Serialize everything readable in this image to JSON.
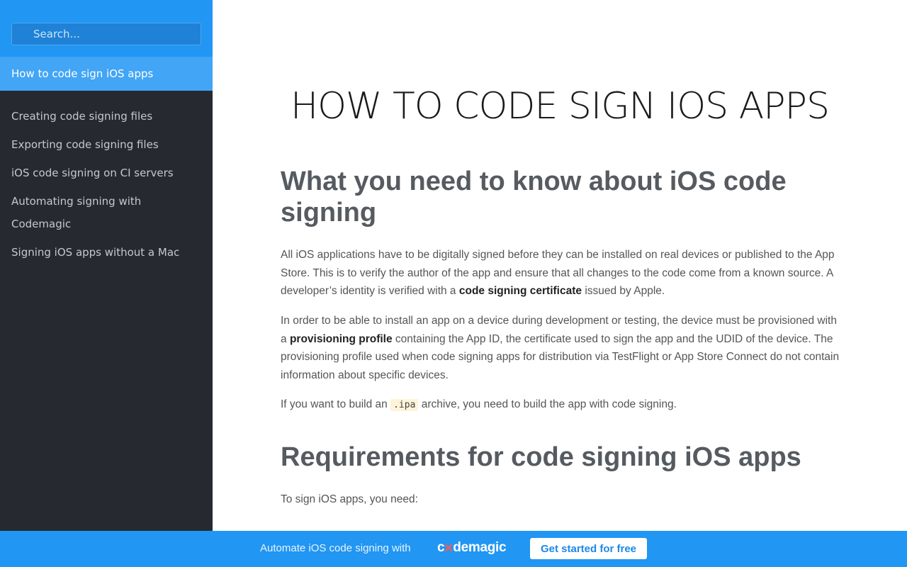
{
  "sidebar": {
    "search": {
      "placeholder": "Search..."
    },
    "active_item": "How to code sign iOS apps",
    "items": [
      "Creating code signing files",
      "Exporting code signing files",
      "iOS code signing on CI servers",
      "Automating signing with Codemagic",
      "Signing iOS apps without a Mac"
    ]
  },
  "main": {
    "title": "HOW TO CODE SIGN IOS APPS",
    "section1": {
      "heading": "What you need to know about iOS code signing",
      "p1_a": "All iOS applications have to be digitally signed before they can be installed on real devices or published to the App Store. This is to verify the author of the app and ensure that all changes to the code come from a known source. A developer’s identity is verified with a ",
      "p1_bold": "code signing certificate",
      "p1_b": " issued by Apple.",
      "p2_a": "In order to be able to install an app on a device during development or testing, the device must be provisioned with a ",
      "p2_bold": "provisioning profile",
      "p2_b": " containing the App ID, the certificate used to sign the app and the UDID of the device. The provisioning profile used when code signing apps for distribution via TestFlight or App Store Connect do not contain information about specific devices.",
      "p3_a": "If you want to build an ",
      "p3_code": ".ipa",
      "p3_b": " archive, you need to build the app with code signing."
    },
    "section2": {
      "heading": "Requirements for code signing iOS apps",
      "p1": "To sign iOS apps, you need:"
    }
  },
  "banner": {
    "text": "Automate iOS code signing with",
    "logo_text": "codemagic",
    "button_label": "Get started for free"
  },
  "colors": {
    "primary": "#2196f3",
    "sidebar_bg": "#262a30",
    "active_item_bg": "#42a5f5",
    "code_bg": "#fff4d9"
  }
}
